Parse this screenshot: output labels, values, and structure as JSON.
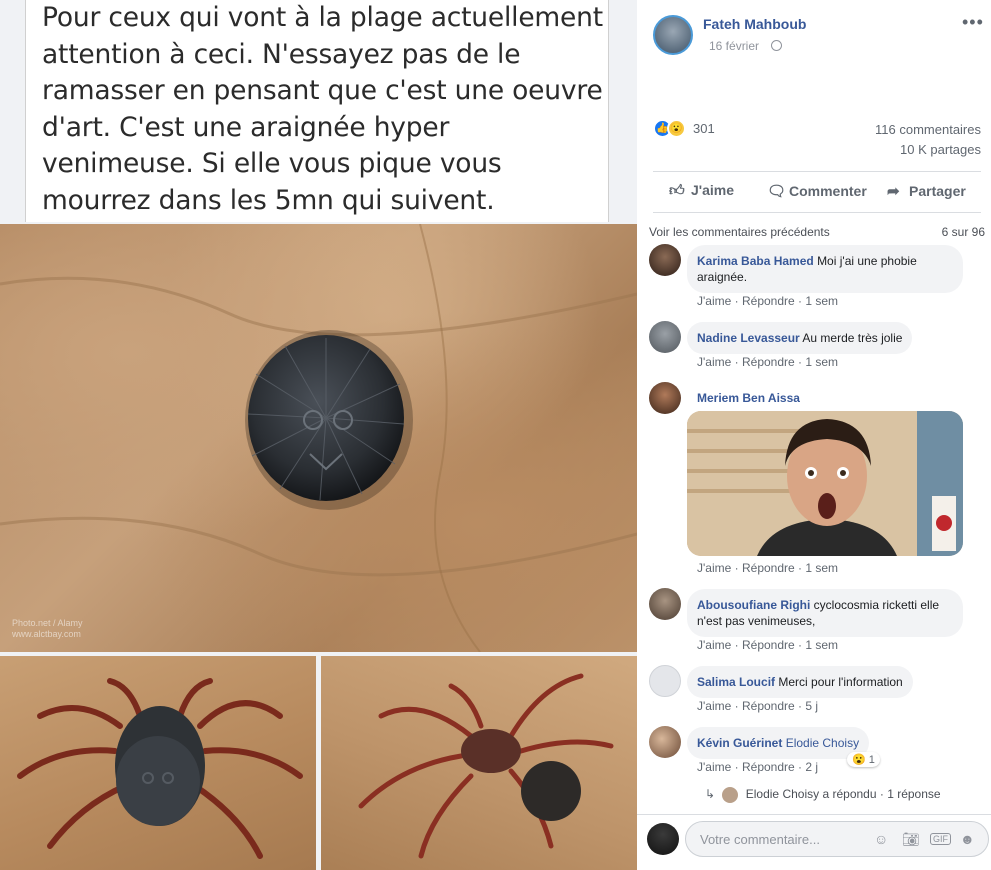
{
  "post_text": "Pour ceux qui vont à la plage actuellement  attention à ceci. N'essayez pas de le ramasser en pensant que c'est une oeuvre d'art.  C'est une araignée hyper venimeuse. Si elle vous pique vous mourrez dans les 5mn qui suivent.",
  "watermark": "Photo.net / Alamy\nwww.alctbay.com",
  "header": {
    "author": "Fateh Mahboub",
    "date": "16 février",
    "more": "•••",
    "privacy_icon": "globe-icon"
  },
  "stats": {
    "reaction_count": "301",
    "comments": "116 commentaires",
    "shares": "10 K partages"
  },
  "actions": {
    "like": "J'aime",
    "comment": "Commenter",
    "share": "Partager"
  },
  "comments_nav": {
    "previous": "Voir les commentaires précédents",
    "pager": "6 sur 96"
  },
  "comments": [
    {
      "name": "Karima Baba Hamed",
      "text": "Moi j'ai une phobie araignée.",
      "like": "J'aime",
      "reply": "Répondre",
      "time": "1 sem"
    },
    {
      "name": "Nadine Levasseur",
      "text": "Au merde très jolie",
      "like": "J'aime",
      "reply": "Répondre",
      "time": "1 sem"
    },
    {
      "name": "Meriem Ben Aissa",
      "text": "",
      "like": "J'aime",
      "reply": "Répondre",
      "time": "1 sem"
    },
    {
      "name": "Abousoufiane Righi",
      "text": "cyclocosmia ricketti elle n'est pas venimeuses,",
      "like": "J'aime",
      "reply": "Répondre",
      "time": "1 sem"
    },
    {
      "name": "Salima Loucif",
      "text": "Merci pour l'information",
      "like": "J'aime",
      "reply": "Répondre",
      "time": "5 j"
    },
    {
      "name": "Kévin Guérinet",
      "mention": "Elodie Choisy",
      "like": "J'aime",
      "reply": "Répondre",
      "time": "2 j",
      "reaction_count": "1"
    }
  ],
  "reply_summary": {
    "name": "Elodie Choisy",
    "text": "a répondu",
    "sep": "·",
    "count": "1 réponse"
  },
  "composer": {
    "placeholder": "Votre commentaire...",
    "gif_label": "GIF"
  },
  "colors": {
    "link": "#385898",
    "meta": "#606770",
    "bubble": "#f2f3f5",
    "like_blue": "#1877f2",
    "wow_yellow": "#f7c93f"
  }
}
